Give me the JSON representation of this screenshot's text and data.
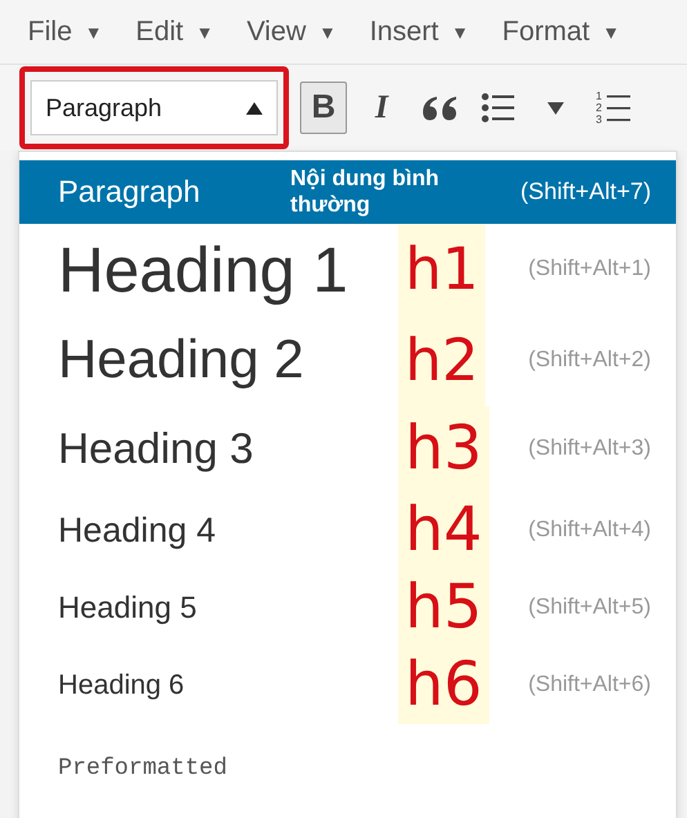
{
  "menu": [
    {
      "label": "File",
      "caret": "▼"
    },
    {
      "label": "Edit",
      "caret": "▼"
    },
    {
      "label": "View",
      "caret": "▼"
    },
    {
      "label": "Insert",
      "caret": "▼"
    },
    {
      "label": "Format",
      "caret": "▼"
    }
  ],
  "format_select": {
    "value": "Paragraph",
    "expanded": true,
    "highlighted": true
  },
  "toolbar": [
    {
      "kind": "bold",
      "label": "B",
      "pressed": true
    },
    {
      "kind": "italic",
      "label": "I",
      "pressed": false
    },
    {
      "kind": "quote",
      "pressed": false
    },
    {
      "kind": "bullets",
      "pressed": false
    },
    {
      "kind": "caret",
      "pressed": false
    },
    {
      "kind": "numbers",
      "digits": [
        "1",
        "2",
        "3"
      ],
      "pressed": false
    }
  ],
  "formats": [
    {
      "kind": "paragraph",
      "label": "Paragraph",
      "note": "Nội dung bình thường",
      "shortcut": "(Shift+Alt+7)",
      "selected": true
    },
    {
      "kind": "h1",
      "label": "Heading 1",
      "tag": "h1",
      "shortcut": "(Shift+Alt+1)",
      "selected": false
    },
    {
      "kind": "h2",
      "label": "Heading 2",
      "tag": "h2",
      "shortcut": "(Shift+Alt+2)",
      "selected": false
    },
    {
      "kind": "h3",
      "label": "Heading 3",
      "tag": "h3",
      "shortcut": "(Shift+Alt+3)",
      "selected": false
    },
    {
      "kind": "h4",
      "label": "Heading 4",
      "tag": "h4",
      "shortcut": "(Shift+Alt+4)",
      "selected": false
    },
    {
      "kind": "h5",
      "label": "Heading 5",
      "tag": "h5",
      "shortcut": "(Shift+Alt+5)",
      "selected": false
    },
    {
      "kind": "h6",
      "label": "Heading 6",
      "tag": "h6",
      "shortcut": "(Shift+Alt+6)",
      "selected": false
    },
    {
      "kind": "pre",
      "label": "Preformatted",
      "selected": false
    }
  ]
}
